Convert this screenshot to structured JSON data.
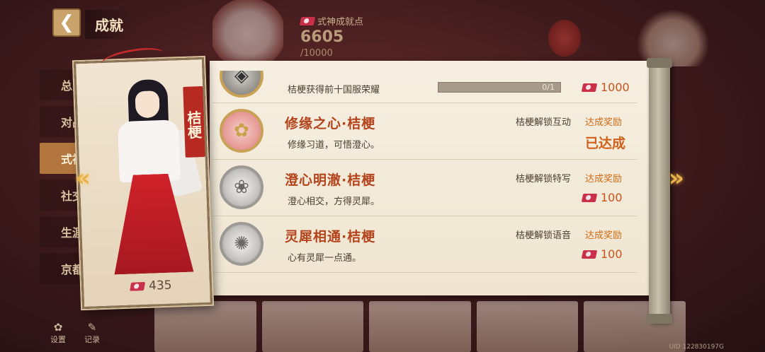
{
  "header": {
    "back_glyph": "❮",
    "title": "成就",
    "points_label": "式神成就点",
    "points_value": "6605",
    "points_max": "/10000"
  },
  "sidebar": {
    "items": [
      {
        "label": "总览"
      },
      {
        "label": "对战"
      },
      {
        "label": "式神"
      },
      {
        "label": "社交"
      },
      {
        "label": "生涯"
      },
      {
        "label": "京都"
      }
    ]
  },
  "footer": {
    "settings_label": "设置",
    "record_label": "记录",
    "uid": "UID 122830197G"
  },
  "character": {
    "name": "桔梗",
    "cost": "435"
  },
  "achievements": [
    {
      "name": "",
      "desc": "桔梗获得前十国服荣耀",
      "progress": "0/1",
      "progress_fraction": 0,
      "reward": "1000",
      "badge_icon": "emblem-icon"
    },
    {
      "name": "修缘之心·桔梗",
      "desc": "修缘习道，可悟澄心。",
      "unlock": "桔梗解锁互动",
      "claim": "达成奖励",
      "status": "已达成",
      "badge_icon": "flower-badge-icon"
    },
    {
      "name": "澄心明澈·桔梗",
      "desc": "澄心相交，方得灵犀。",
      "unlock": "桔梗解锁特写",
      "claim": "达成奖励",
      "reward": "100",
      "badge_icon": "silver-flower-badge-icon"
    },
    {
      "name": "灵犀相通·桔梗",
      "desc": "心有灵犀一点通。",
      "unlock": "桔梗解锁语音",
      "claim": "达成奖励",
      "reward": "100",
      "badge_icon": "silver-wheel-badge-icon"
    }
  ],
  "colors": {
    "accent_orange": "#d06a14",
    "title_red": "#b4441c",
    "ticket": "#c9304a"
  }
}
